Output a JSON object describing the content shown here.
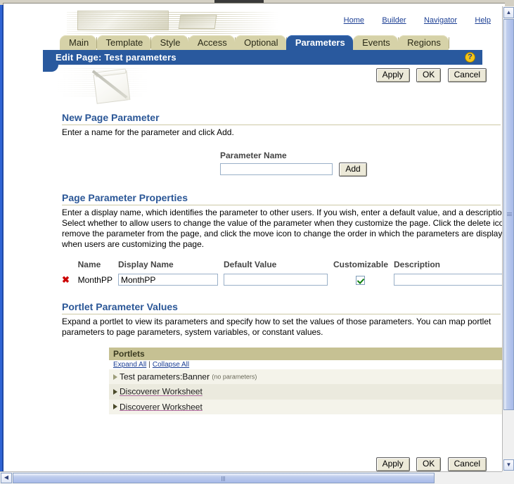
{
  "global_nav": {
    "links": [
      {
        "label": "Home",
        "name": "nav-link-home"
      },
      {
        "label": "Builder",
        "name": "nav-link-builder"
      },
      {
        "label": "Navigator",
        "name": "nav-link-navigator"
      },
      {
        "label": "Help",
        "name": "nav-link-help"
      }
    ]
  },
  "tabs": [
    {
      "label": "Main",
      "selected": false
    },
    {
      "label": "Template",
      "selected": false
    },
    {
      "label": "Style",
      "selected": false
    },
    {
      "label": "Access",
      "selected": false
    },
    {
      "label": "Optional",
      "selected": false
    },
    {
      "label": "Parameters",
      "selected": true
    },
    {
      "label": "Events",
      "selected": false
    },
    {
      "label": "Regions",
      "selected": false
    }
  ],
  "titlebar": {
    "title": "Edit Page: Test parameters",
    "help_icon": "question-mark-icon",
    "help_glyph": "?"
  },
  "actions_top": {
    "apply": "Apply",
    "ok": "OK",
    "cancel": "Cancel"
  },
  "actions_bottom": {
    "apply": "Apply",
    "ok": "OK",
    "cancel": "Cancel"
  },
  "new_page_parameter": {
    "heading": "New Page Parameter",
    "instructions": "Enter a name for the parameter and click Add.",
    "field_label": "Parameter Name",
    "field_value": "",
    "field_placeholder": "",
    "add_button": "Add"
  },
  "page_parameter_properties": {
    "heading": "Page Parameter Properties",
    "instructions": "Enter a display name, which identifies the parameter to other users. If you wish, enter a default value, and a description. Select whether to allow users to change the value of the parameter when they customize the page. Click the delete icon to remove the parameter from the page, and click the move icon to change the order in which the parameters are displayed when users are customizing the page.",
    "columns": [
      "Name",
      "Display Name",
      "Default Value",
      "Customizable",
      "Description"
    ],
    "rows": [
      {
        "delete_icon": "delete-x-icon",
        "delete_glyph": "✖",
        "name": "MonthPP",
        "display_name": "MonthPP",
        "default_value": "",
        "customizable": true,
        "description": ""
      }
    ]
  },
  "portlet_parameter_values": {
    "heading": "Portlet Parameter Values",
    "instructions": "Expand a portlet to view its parameters and specify how to set the values of those parameters. You can map portlet parameters to page parameters, system variables, or constant values.",
    "table_header": "Portlets",
    "expand_all": "Expand All",
    "separator": "|",
    "collapse_all": "Collapse All",
    "rows": [
      {
        "label": "Test parameters:Banner",
        "note": "(no parameters)",
        "is_link": false,
        "arrow": "expand-arrow-icon"
      },
      {
        "label": "Discoverer Worksheet",
        "note": "",
        "is_link": true,
        "arrow": "expand-arrow-icon"
      },
      {
        "label": "Discoverer Worksheet",
        "note": "",
        "is_link": true,
        "arrow": "expand-arrow-icon"
      }
    ]
  },
  "scrollbars": {
    "vertical_up": "▲",
    "vertical_down": "▼",
    "horizontal_left": "◀",
    "horizontal_right": "▶"
  },
  "colors": {
    "accent_blue": "#29599e",
    "tab_tan": "#d6d2a8",
    "heading_blue": "#2b5797",
    "link_blue": "#1c3f94",
    "portlet_header_tan": "#c6c193",
    "delete_red": "#cc0000",
    "check_green": "#108010"
  }
}
